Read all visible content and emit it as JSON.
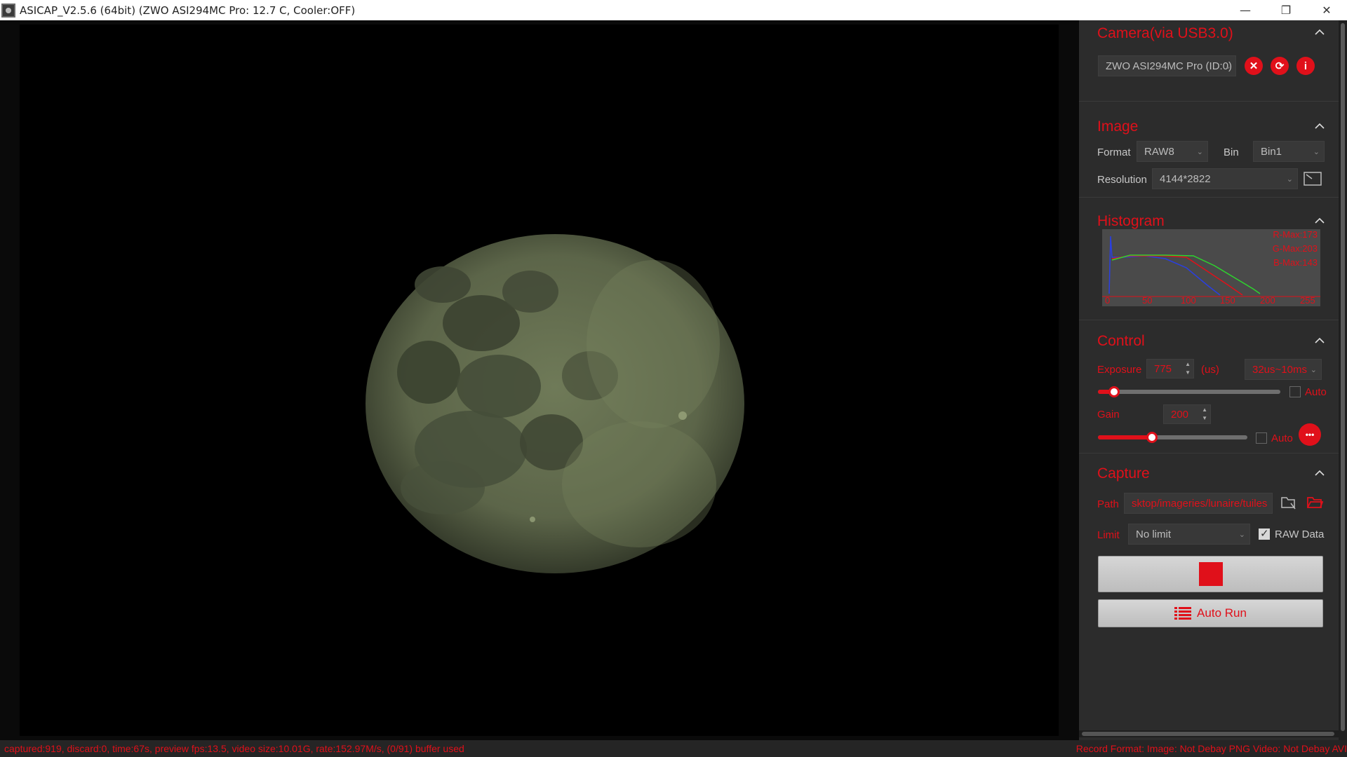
{
  "window": {
    "title": "ASICAP_V2.5.6 (64bit) (ZWO ASI294MC Pro: 12.7 C, Cooler:OFF)",
    "minimize": "—",
    "restore": "❐",
    "close": "✕"
  },
  "camera": {
    "title": "Camera(via USB3.0)",
    "selected": "ZWO ASI294MC Pro (ID:0)",
    "buttons": {
      "disconnect": "✕",
      "refresh": "⟳",
      "info": "i"
    }
  },
  "image": {
    "title": "Image",
    "format_label": "Format",
    "format_value": "RAW8",
    "bin_label": "Bin",
    "bin_value": "Bin1",
    "resolution_label": "Resolution",
    "resolution_value": "4144*2822"
  },
  "histogram": {
    "title": "Histogram",
    "r_max": "R-Max:173",
    "g_max": "G-Max:203",
    "b_max": "B-Max:143",
    "ticks": [
      "0",
      "50",
      "100",
      "150",
      "200",
      "255"
    ]
  },
  "control": {
    "title": "Control",
    "exposure_label": "Exposure",
    "exposure_value": "775",
    "exposure_unit": "(us)",
    "exposure_range": "32us~10ms",
    "exposure_slider": 0.09,
    "exposure_auto": "Auto",
    "gain_label": "Gain",
    "gain_value": "200",
    "gain_slider": 0.36,
    "gain_auto": "Auto",
    "more": "•••"
  },
  "capture": {
    "title": "Capture",
    "path_label": "Path",
    "path_value": "sktop/imageries/lunaire/tuiles",
    "limit_label": "Limit",
    "limit_value": "No limit",
    "raw_label": "RAW Data",
    "raw_checked": true,
    "auto_run_label": "Auto Run"
  },
  "status": {
    "left": "captured:919, discard:0, time:67s, preview fps:13.5, video size:10.01G, rate:152.97M/s, (0/91) buffer used",
    "right": "Record Format: Image: Not Debay PNG Video: Not Debay AVI"
  },
  "colors": {
    "accent": "#e0101a",
    "panel": "#2c2c2c"
  }
}
